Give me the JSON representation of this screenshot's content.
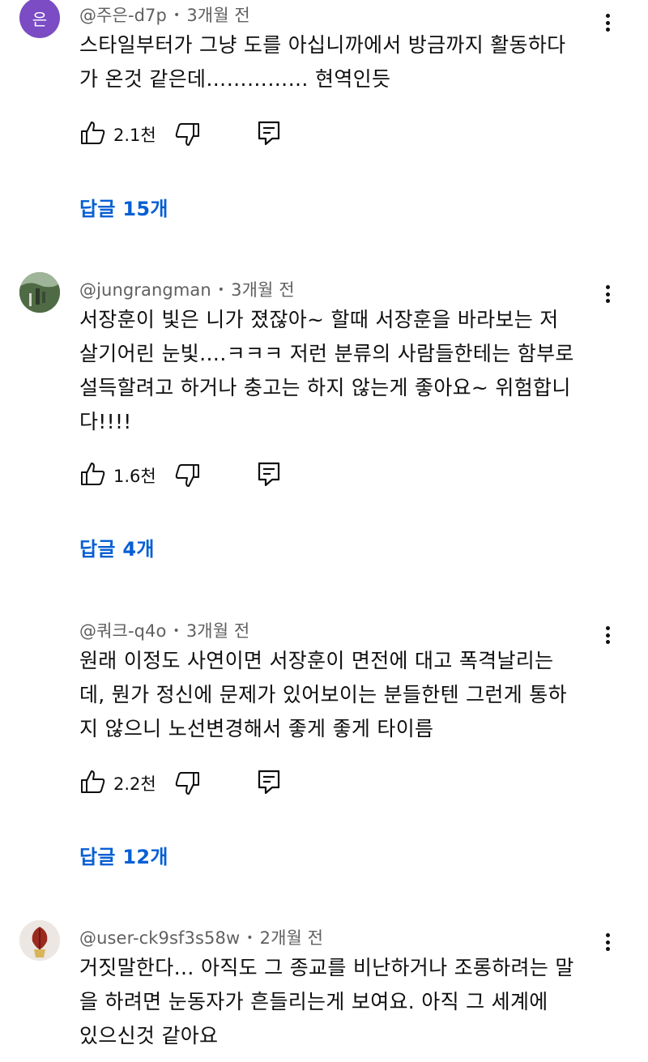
{
  "comments": [
    {
      "handle": "@주은-d7p",
      "time": "3개월 전",
      "avatar_letter": "은",
      "lines": [
        "스타일부터가 그냥 도를 아십니까에서 방금까지 활동하다",
        "가 온것 같은데…………… 현역인듯"
      ],
      "likes": "2.1천",
      "replies": "답글 15개"
    },
    {
      "handle": "@jungrangman",
      "time": "3개월 전",
      "lines": [
        "서장훈이 빛은 니가 졌잖아~ 할때 서장훈을 바라보는 저",
        "살기어린 눈빛….ㅋㅋㅋ 저런 분류의 사람들한테는 함부로",
        "설득할려고 하거나 충고는 하지 않는게 좋아요~ 위험합니",
        "다!!!!"
      ],
      "likes": "1.6천",
      "replies": "답글 4개"
    },
    {
      "handle": "@쿼크-q4o",
      "time": "3개월 전",
      "lines": [
        "원래 이정도 사연이면 서장훈이 면전에 대고 폭격날리는",
        "데, 뭔가 정신에 문제가 있어보이는 분들한텐 그런게 통하",
        "지 않으니 노선변경해서 좋게 좋게 타이름"
      ],
      "likes": "2.2천",
      "replies": "답글 12개"
    },
    {
      "handle": "@user-ck9sf3s58w",
      "time": "2개월 전",
      "lines": [
        "거짓말한다… 아직도 그 종교를 비난하거나 조롱하려는 말",
        "을 하려면  눈동자가 흔들리는게 보여요. 아직 그 세계에",
        "있으신것 같아요"
      ]
    }
  ],
  "icons": {
    "like": "thumbs-up-icon",
    "dislike": "thumbs-down-icon",
    "reply": "reply-icon",
    "more": "more-vertical-icon"
  },
  "colors": {
    "link": "#065fd4",
    "meta": "#606060",
    "text": "#0f0f0f",
    "avatar_purple": "#7b4cc4"
  }
}
